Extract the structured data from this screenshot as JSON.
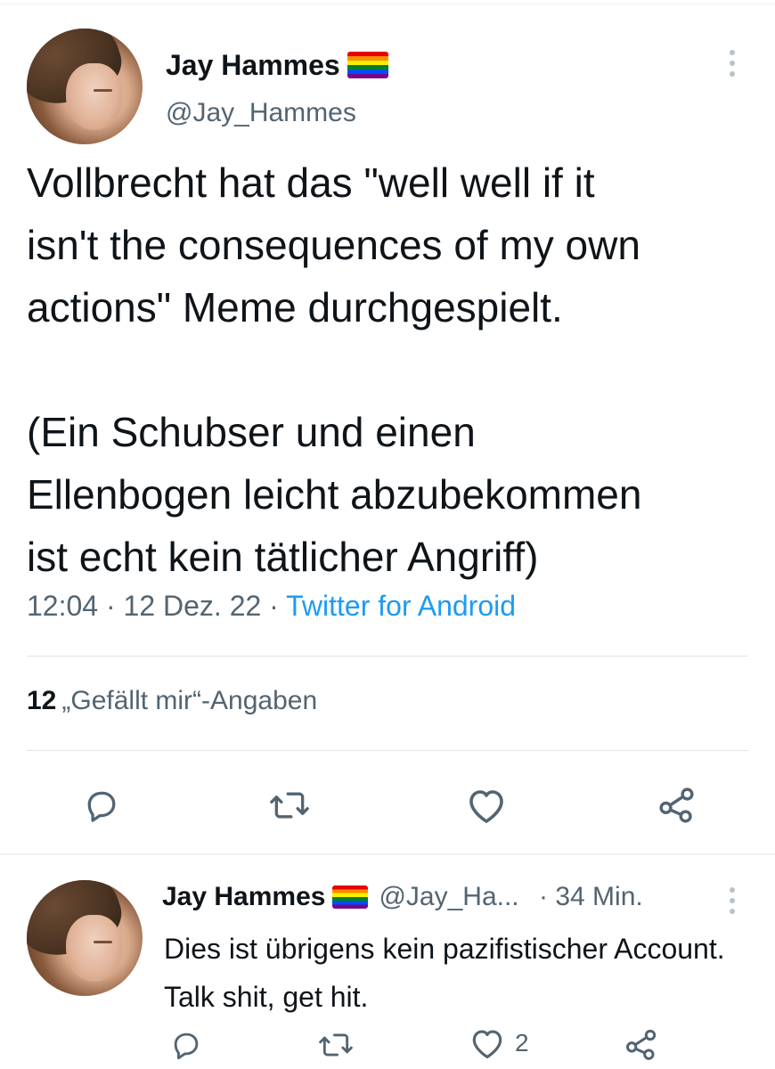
{
  "tweet": {
    "author": {
      "name": "Jay Hammes",
      "handle": "@Jay_Hammes",
      "flag_icon": "rainbow-flag-emoji"
    },
    "text": "Vollbrecht hat das \"well well if it\nisn't the consequences of my own\nactions\" Meme durchgespielt.\n\n(Ein Schubser und einen\nEllenbogen leicht abzubekommen\nist echt kein tätlicher Angriff)",
    "time": "12:04",
    "separator": "·",
    "date": "12 Dez. 22",
    "source": "Twitter for Android",
    "likes_count": "12",
    "likes_label": "„Gefällt mir“-Angaben",
    "actions": [
      "reply-icon",
      "retweet-icon",
      "like-icon",
      "share-icon"
    ]
  },
  "reply": {
    "author": {
      "name": "Jay Hammes",
      "handle": "@Jay_Ha...",
      "flag_icon": "rainbow-flag-emoji"
    },
    "separator": "·",
    "time_ago": "34 Min.",
    "text": "Dies ist übrigens kein pazifistischer Account. Talk shit, get hit.",
    "like_count": "2",
    "actions": [
      "reply-icon",
      "retweet-icon",
      "like-icon",
      "share-icon"
    ]
  },
  "colors": {
    "text": "#0f1419",
    "secondary": "#536471",
    "link": "#1d9bf0",
    "divider": "#eff3f4"
  }
}
